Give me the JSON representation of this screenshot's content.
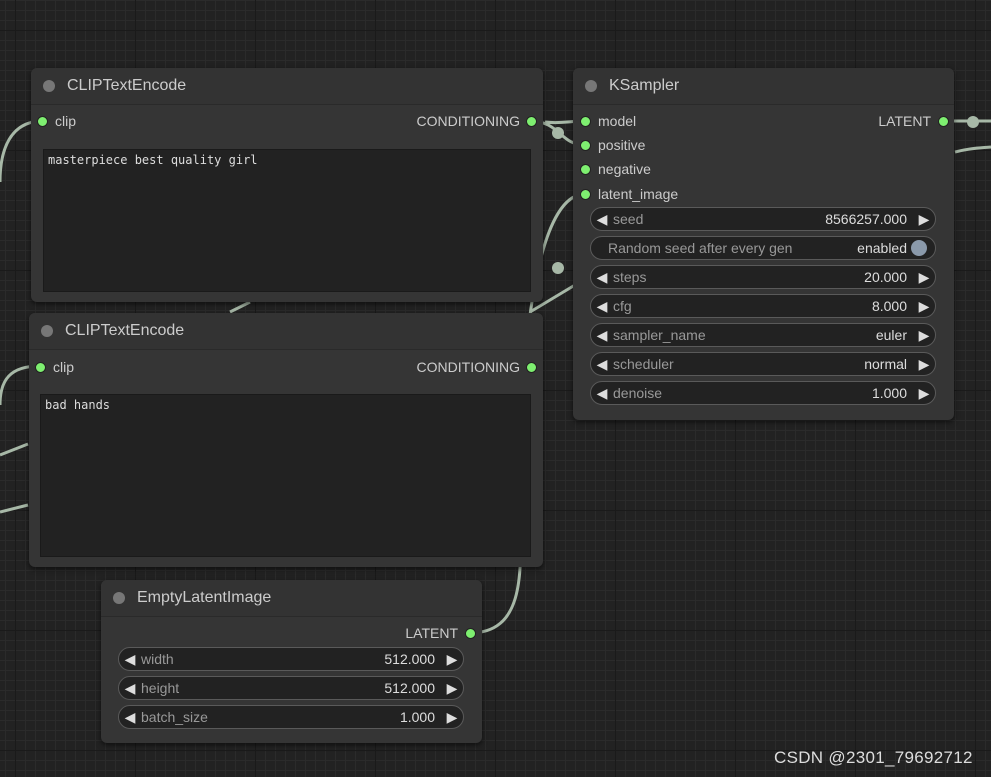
{
  "nodes": {
    "clip_pos": {
      "title": "CLIPTextEncode",
      "input": "clip",
      "output": "CONDITIONING",
      "text": "masterpiece best quality girl"
    },
    "clip_neg": {
      "title": "CLIPTextEncode",
      "input": "clip",
      "output": "CONDITIONING",
      "text": "bad hands"
    },
    "ksampler": {
      "title": "KSampler",
      "inputs": {
        "model": "model",
        "positive": "positive",
        "negative": "negative",
        "latent_image": "latent_image"
      },
      "output": "LATENT",
      "widgets": {
        "seed": {
          "label": "seed",
          "value": "8566257.000"
        },
        "random_seed": {
          "label": "Random seed after every gen",
          "value": "enabled"
        },
        "steps": {
          "label": "steps",
          "value": "20.000"
        },
        "cfg": {
          "label": "cfg",
          "value": "8.000"
        },
        "sampler_name": {
          "label": "sampler_name",
          "value": "euler"
        },
        "scheduler": {
          "label": "scheduler",
          "value": "normal"
        },
        "denoise": {
          "label": "denoise",
          "value": "1.000"
        }
      }
    },
    "empty_latent": {
      "title": "EmptyLatentImage",
      "output": "LATENT",
      "widgets": {
        "width": {
          "label": "width",
          "value": "512.000"
        },
        "height": {
          "label": "height",
          "value": "512.000"
        },
        "batch_size": {
          "label": "batch_size",
          "value": "1.000"
        }
      }
    }
  },
  "arrows": {
    "left": "◀",
    "right": "▶"
  },
  "watermark": "CSDN @2301_79692712",
  "colors": {
    "canvas": "#222222",
    "node_body": "#353535",
    "slot_dot": "#7eef70",
    "link": "#a7b8a7"
  }
}
